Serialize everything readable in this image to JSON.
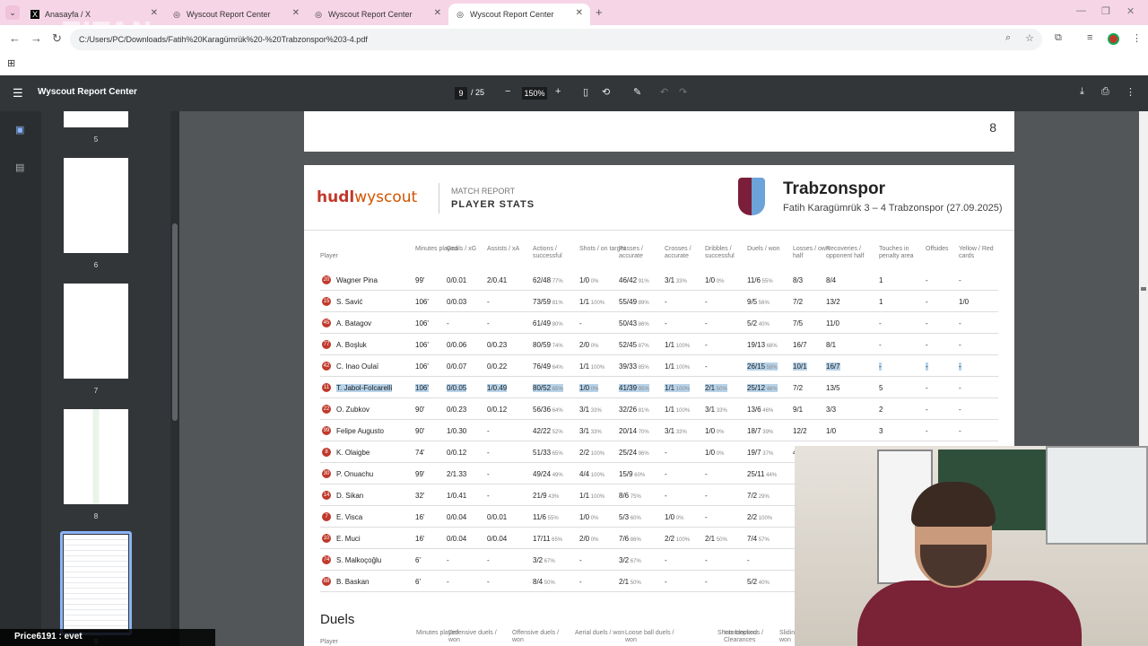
{
  "browser": {
    "tabs": [
      {
        "label": "Anasayfa / X",
        "icon": "x-logo-icon"
      },
      {
        "label": "Wyscout Report Center",
        "icon": "globe-icon"
      },
      {
        "label": "Wyscout Report Center",
        "icon": "globe-icon"
      },
      {
        "label": "Wyscout Report Center",
        "icon": "globe-icon",
        "active": true
      }
    ],
    "address": "C:/Users/PC/Downloads/Fatih%20Karagümrük%20-%20Trabzonspor%203-4.pdf",
    "watermark": "TITAN"
  },
  "pdf": {
    "title": "Wyscout Report Center",
    "page_current": "9",
    "page_total": "/ 25",
    "zoom": "150%",
    "prev_page_number": "8",
    "thumbnails": [
      "5",
      "6",
      "7",
      "8",
      "9"
    ]
  },
  "report": {
    "logo_hudl": "hudl",
    "logo_wyscout": "wyscout",
    "section_label": "MATCH REPORT",
    "section_title": "PLAYER STATS",
    "team": "Trabzonspor",
    "match": "Fatih Karagümrük 3 – 4 Trabzonspor (27.09.2025)",
    "headers": [
      "Player",
      "Minutes played",
      "Goals / xG",
      "Assists / xA",
      "Actions / successful",
      "Shots / on target",
      "Passes / accurate",
      "Crosses / accurate",
      "Dribbles / successful",
      "Duels / won",
      "Losses / own half",
      "Recoveries / opponent half",
      "Touches in penalty area",
      "Offsides",
      "Yellow / Red cards"
    ],
    "rows": [
      {
        "num": "20",
        "player": "Wagner Pina",
        "min": "99'",
        "goals": "0/0.01",
        "assists": "2/0.41",
        "actions": "62/48",
        "actions_p": "77%",
        "shots": "1/0",
        "shots_p": "0%",
        "passes": "46/42",
        "passes_p": "91%",
        "crosses": "3/1",
        "crosses_p": "33%",
        "dribbles": "1/0",
        "dribbles_p": "0%",
        "duels": "11/6",
        "duels_p": "55%",
        "losses": "8/3",
        "recov": "8/4",
        "touches": "1",
        "offsides": "-",
        "cards": "-"
      },
      {
        "num": "15",
        "player": "S. Savić",
        "min": "106'",
        "goals": "0/0.03",
        "assists": "-",
        "actions": "73/59",
        "actions_p": "81%",
        "shots": "1/1",
        "shots_p": "100%",
        "passes": "55/49",
        "passes_p": "89%",
        "crosses": "-",
        "crosses_p": "",
        "dribbles": "-",
        "dribbles_p": "",
        "duels": "9/5",
        "duels_p": "56%",
        "losses": "7/2",
        "recov": "13/2",
        "touches": "1",
        "offsides": "-",
        "cards": "1/0"
      },
      {
        "num": "45",
        "player": "A. Batagov",
        "min": "106'",
        "goals": "-",
        "assists": "-",
        "actions": "61/49",
        "actions_p": "80%",
        "shots": "-",
        "shots_p": "",
        "passes": "50/43",
        "passes_p": "86%",
        "crosses": "-",
        "crosses_p": "",
        "dribbles": "-",
        "dribbles_p": "",
        "duels": "5/2",
        "duels_p": "40%",
        "losses": "7/5",
        "recov": "11/0",
        "touches": "-",
        "offsides": "-",
        "cards": "-"
      },
      {
        "num": "77",
        "player": "A. Boşluk",
        "min": "106'",
        "goals": "0/0.06",
        "assists": "0/0.23",
        "actions": "80/59",
        "actions_p": "74%",
        "shots": "2/0",
        "shots_p": "0%",
        "passes": "52/45",
        "passes_p": "87%",
        "crosses": "1/1",
        "crosses_p": "100%",
        "dribbles": "-",
        "dribbles_p": "",
        "duels": "19/13",
        "duels_p": "68%",
        "losses": "16/7",
        "recov": "8/1",
        "touches": "-",
        "offsides": "-",
        "cards": "-"
      },
      {
        "num": "42",
        "player": "C. Inao Oulaï",
        "min": "106'",
        "goals": "0/0.07",
        "assists": "0/0.22",
        "actions": "76/49",
        "actions_p": "64%",
        "shots": "1/1",
        "shots_p": "100%",
        "passes": "39/33",
        "passes_p": "85%",
        "crosses": "1/1",
        "crosses_p": "100%",
        "dribbles": "-",
        "dribbles_p": "",
        "duels": "26/15",
        "duels_p": "58%",
        "losses": "10/1",
        "recov": "16/7",
        "touches": "-",
        "offsides": "-",
        "cards": "-"
      },
      {
        "num": "11",
        "player": "T. Jabol-Folcarelli",
        "min": "106'",
        "goals": "0/0.05",
        "assists": "1/0.49",
        "actions": "80/52",
        "actions_p": "65%",
        "shots": "1/0",
        "shots_p": "0%",
        "passes": "41/39",
        "passes_p": "95%",
        "crosses": "1/1",
        "crosses_p": "100%",
        "dribbles": "2/1",
        "dribbles_p": "50%",
        "duels": "25/12",
        "duels_p": "48%",
        "losses": "7/2",
        "recov": "13/5",
        "touches": "5",
        "offsides": "-",
        "cards": "-"
      },
      {
        "num": "22",
        "player": "O. Zubkov",
        "min": "90'",
        "goals": "0/0.23",
        "assists": "0/0.12",
        "actions": "56/36",
        "actions_p": "64%",
        "shots": "3/1",
        "shots_p": "33%",
        "passes": "32/26",
        "passes_p": "81%",
        "crosses": "1/1",
        "crosses_p": "100%",
        "dribbles": "3/1",
        "dribbles_p": "33%",
        "duels": "13/6",
        "duels_p": "46%",
        "losses": "9/1",
        "recov": "3/3",
        "touches": "2",
        "offsides": "-",
        "cards": "-"
      },
      {
        "num": "99",
        "player": "Felipe Augusto",
        "min": "90'",
        "goals": "1/0.30",
        "assists": "-",
        "actions": "42/22",
        "actions_p": "52%",
        "shots": "3/1",
        "shots_p": "33%",
        "passes": "20/14",
        "passes_p": "70%",
        "crosses": "3/1",
        "crosses_p": "33%",
        "dribbles": "1/0",
        "dribbles_p": "0%",
        "duels": "18/7",
        "duels_p": "39%",
        "losses": "12/2",
        "recov": "1/0",
        "touches": "3",
        "offsides": "-",
        "cards": "-"
      },
      {
        "num": "8",
        "player": "K. Olaigbe",
        "min": "74'",
        "goals": "0/0.12",
        "assists": "-",
        "actions": "51/33",
        "actions_p": "65%",
        "shots": "2/2",
        "shots_p": "100%",
        "passes": "25/24",
        "passes_p": "96%",
        "crosses": "-",
        "crosses_p": "",
        "dribbles": "1/0",
        "dribbles_p": "0%",
        "duels": "19/7",
        "duels_p": "37%",
        "losses": "4/2",
        "recov": "",
        "touches": "",
        "offsides": "",
        "cards": ""
      },
      {
        "num": "30",
        "player": "P. Onuachu",
        "min": "99'",
        "goals": "2/1.33",
        "assists": "-",
        "actions": "49/24",
        "actions_p": "49%",
        "shots": "4/4",
        "shots_p": "100%",
        "passes": "15/9",
        "passes_p": "60%",
        "crosses": "-",
        "crosses_p": "",
        "dribbles": "-",
        "dribbles_p": "",
        "duels": "25/11",
        "duels_p": "44%",
        "losses": "",
        "recov": "",
        "touches": "",
        "offsides": "",
        "cards": ""
      },
      {
        "num": "14",
        "player": "D. Sikan",
        "min": "32'",
        "goals": "1/0.41",
        "assists": "-",
        "actions": "21/9",
        "actions_p": "43%",
        "shots": "1/1",
        "shots_p": "100%",
        "passes": "8/6",
        "passes_p": "75%",
        "crosses": "-",
        "crosses_p": "",
        "dribbles": "-",
        "dribbles_p": "",
        "duels": "7/2",
        "duels_p": "29%",
        "losses": "",
        "recov": "",
        "touches": "",
        "offsides": "",
        "cards": ""
      },
      {
        "num": "7",
        "player": "E. Visca",
        "min": "16'",
        "goals": "0/0.04",
        "assists": "0/0.01",
        "actions": "11/6",
        "actions_p": "55%",
        "shots": "1/0",
        "shots_p": "0%",
        "passes": "5/3",
        "passes_p": "60%",
        "crosses": "1/0",
        "crosses_p": "0%",
        "dribbles": "-",
        "dribbles_p": "",
        "duels": "2/2",
        "duels_p": "100%",
        "losses": "",
        "recov": "",
        "touches": "",
        "offsides": "",
        "cards": ""
      },
      {
        "num": "10",
        "player": "E. Muci",
        "min": "16'",
        "goals": "0/0.04",
        "assists": "0/0.04",
        "actions": "17/11",
        "actions_p": "65%",
        "shots": "2/0",
        "shots_p": "0%",
        "passes": "7/6",
        "passes_p": "86%",
        "crosses": "2/2",
        "crosses_p": "100%",
        "dribbles": "2/1",
        "dribbles_p": "50%",
        "duels": "7/4",
        "duels_p": "57%",
        "losses": "",
        "recov": "",
        "touches": "",
        "offsides": "",
        "cards": ""
      },
      {
        "num": "74",
        "player": "S. Malkoçoğlu",
        "min": "6'",
        "goals": "-",
        "assists": "-",
        "actions": "3/2",
        "actions_p": "67%",
        "shots": "-",
        "shots_p": "",
        "passes": "3/2",
        "passes_p": "67%",
        "crosses": "-",
        "crosses_p": "",
        "dribbles": "-",
        "dribbles_p": "",
        "duels": "-",
        "duels_p": "",
        "losses": "",
        "recov": "",
        "touches": "",
        "offsides": "",
        "cards": ""
      },
      {
        "num": "88",
        "player": "B. Baskan",
        "min": "6'",
        "goals": "-",
        "assists": "-",
        "actions": "8/4",
        "actions_p": "50%",
        "shots": "-",
        "shots_p": "",
        "passes": "2/1",
        "passes_p": "50%",
        "crosses": "-",
        "crosses_p": "",
        "dribbles": "-",
        "dribbles_p": "",
        "duels": "5/2",
        "duels_p": "40%",
        "losses": "",
        "recov": "",
        "touches": "",
        "offsides": "",
        "cards": ""
      }
    ],
    "duels_title": "Duels",
    "duels_headers": [
      "Player",
      "Minutes played",
      "Defensive duels / won",
      "Offensive duels / won",
      "Aerial duels / won",
      "Loose ball duels / won",
      "Shots blocked",
      "Interceptions / Clearances",
      "Sliding tackles / won"
    ]
  },
  "chat": {
    "text": "Price6191 : evet"
  },
  "colors": {
    "accent": "#c0392b",
    "highlight": "#b7d3ea",
    "tabstrip": "#f6d5e6",
    "pdfbar": "#323639"
  }
}
